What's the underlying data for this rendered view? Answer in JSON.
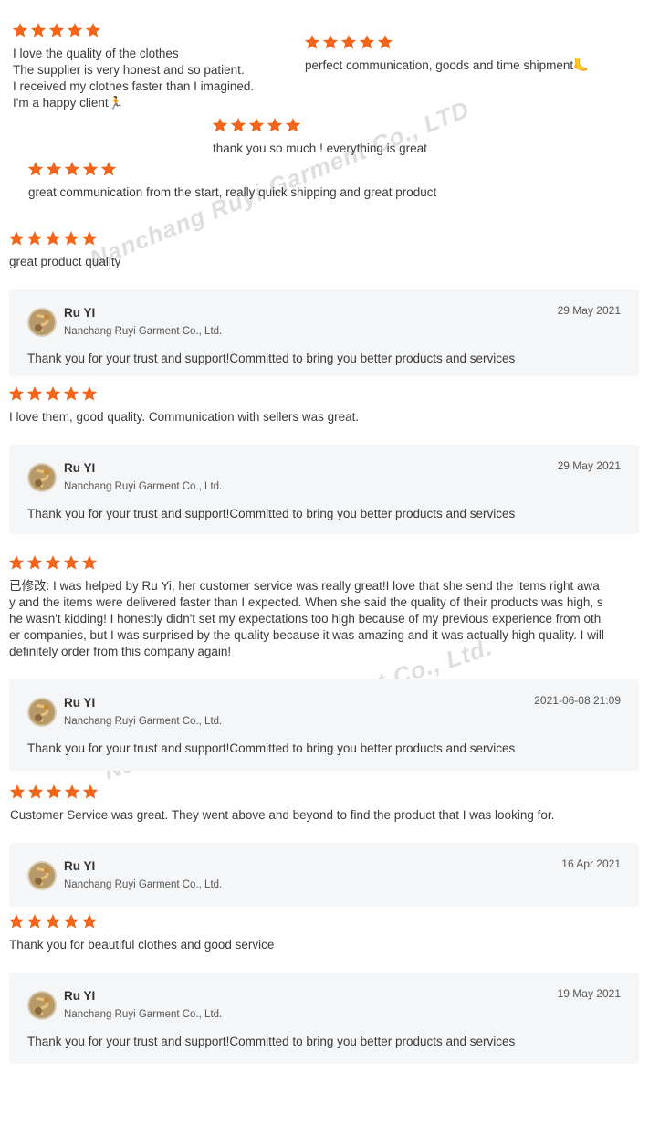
{
  "colors": {
    "star": "#f2651b",
    "reply_bg": "#f5f6f8"
  },
  "icons": {
    "star": "star-icon",
    "avatar": "avatar-image"
  },
  "watermark": "Nanchang Ruyi Garment Co., LTD",
  "top_reviews": [
    {
      "lines": [
        "I love the quality of the clothes",
        "The supplier is very honest and so patient.",
        "I received my clothes faster than I imagined.",
        "I'm a happy client🏃"
      ]
    },
    {
      "lines": [
        "perfect communication, goods and time shipment🦶"
      ]
    },
    {
      "lines": [
        "thank you so much ! everything is great"
      ]
    },
    {
      "lines": [
        "great communication from the start, really quick shipping and great product"
      ]
    },
    {
      "lines": [
        "great product quality"
      ]
    }
  ],
  "reviews": [
    {
      "text": "I love them, good quality. Communication with sellers was great.",
      "reply": {
        "name": "Ru YI",
        "company": "Nanchang Ruyi Garment Co., Ltd.",
        "date": "29 May 2021",
        "message": "Thank you for your trust and support!Committed to bring you better products and services"
      }
    },
    {
      "text": "已修改: I was helped by Ru Yi, her customer service was really great!I love that she send the items right away and the items were delivered faster than I expected. When she said the quality of their products was high, she wasn't kidding! I honestly didn't set my expectations too high because of my previous experience from other companies,  but I was surprised by the quality because it was amazing and it was actually high quality. I will definitely order from this company again!",
      "reply": {
        "name": "Ru YI",
        "company": "Nanchang Ruyi Garment Co., Ltd.",
        "date": "2021-06-08 21:09",
        "message": "Thank you for your trust and support!Committed to bring you better products and services"
      }
    },
    {
      "text": "Customer Service was great. They went above and beyond to find the product that I was looking for.",
      "reply": {
        "name": "Ru YI",
        "company": "Nanchang Ruyi Garment Co., Ltd.",
        "date": "16 Apr 2021",
        "message": ""
      }
    },
    {
      "text": "Thank you for beautiful clothes and good service",
      "reply": {
        "name": "Ru YI",
        "company": "Nanchang Ruyi Garment Co., Ltd.",
        "date": "19 May 2021",
        "message": "Thank you for your trust and support!Committed to bring you better products and services"
      }
    }
  ],
  "first_reply": {
    "name": "Ru YI",
    "company": "Nanchang Ruyi Garment Co., Ltd.",
    "date": "29 May 2021",
    "message": "Thank you for your trust and support!Committed to bring you better products and services"
  }
}
